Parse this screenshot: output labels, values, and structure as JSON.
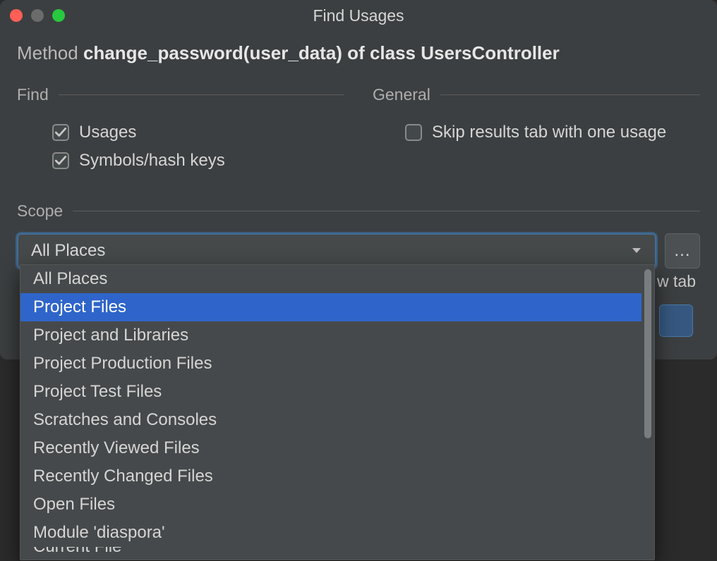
{
  "window": {
    "title": "Find Usages"
  },
  "subject": {
    "prefix": "Method ",
    "bold": "change_password(user_data) of class UsersController"
  },
  "find": {
    "label": "Find",
    "usages": {
      "label": "Usages",
      "checked": true
    },
    "symbols": {
      "label": "Symbols/hash keys",
      "checked": true
    }
  },
  "general": {
    "label": "General",
    "skip": {
      "label": "Skip results tab with one usage",
      "checked": false
    }
  },
  "scope": {
    "label": "Scope",
    "selected": "All Places",
    "more_button": "...",
    "open_new_tab_partial": "w tab",
    "options": [
      "All Places",
      "Project Files",
      "Project and Libraries",
      "Project Production Files",
      "Project Test Files",
      "Scratches and Consoles",
      "Recently Viewed Files",
      "Recently Changed Files",
      "Open Files",
      "Module 'diaspora'",
      "Current File"
    ],
    "highlighted_index": 1
  },
  "colors": {
    "selection": "#2f65ca",
    "window_bg": "#3c3f41",
    "focus_border": "#466d94"
  }
}
